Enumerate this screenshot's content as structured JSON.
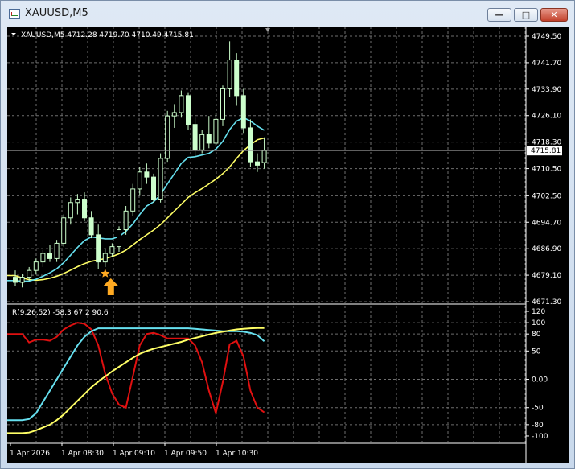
{
  "window": {
    "title": "XAUUSD,M5",
    "min_glyph": "—",
    "max_glyph": "□",
    "close_glyph": "✕"
  },
  "colors": {
    "background": "#000000",
    "grid": "#6e6e6e",
    "text": "#ffffff",
    "candle_bull": "#ccffcc",
    "candle_bear": "#ccffcc",
    "ma_fast": "#66e0ef",
    "ma_slow": "#ffff66",
    "indicator_red": "#e01010",
    "marker": "#ffaa22"
  },
  "chart_data": [
    {
      "type": "candlestick",
      "header": "XAUUSD,M5  4712.28 4719.70 4710.49 4715.81",
      "symbol": "XAUUSD",
      "timeframe": "M5",
      "ohlc_header": [
        "4712.28",
        "4719.70",
        "4710.49",
        "4715.81"
      ],
      "y_ticks": [
        "4749.50",
        "4741.70",
        "4733.90",
        "4726.10",
        "4718.30",
        "4710.50",
        "4702.50",
        "4694.70",
        "4686.90",
        "4679.10",
        "4671.30"
      ],
      "ylim": [
        4671.3,
        4749.5
      ],
      "current_price": "4715.81",
      "x_ticks": [
        "1 Apr 2026",
        "1 Apr 08:30",
        "1 Apr 09:10",
        "1 Apr 09:50",
        "1 Apr 10:30"
      ],
      "candles": [
        {
          "o": 4678.5,
          "h": 4680.5,
          "l": 4676.0,
          "c": 4677.0
        },
        {
          "o": 4677.0,
          "h": 4679.5,
          "l": 4675.5,
          "c": 4678.5
        },
        {
          "o": 4678.5,
          "h": 4681.5,
          "l": 4677.5,
          "c": 4680.5
        },
        {
          "o": 4680.5,
          "h": 4684.0,
          "l": 4679.5,
          "c": 4683.0
        },
        {
          "o": 4683.0,
          "h": 4686.5,
          "l": 4681.5,
          "c": 4685.5
        },
        {
          "o": 4685.5,
          "h": 4688.0,
          "l": 4683.0,
          "c": 4684.0
        },
        {
          "o": 4684.0,
          "h": 4689.5,
          "l": 4683.0,
          "c": 4688.5
        },
        {
          "o": 4688.5,
          "h": 4697.0,
          "l": 4687.5,
          "c": 4696.0
        },
        {
          "o": 4696.0,
          "h": 4702.0,
          "l": 4694.0,
          "c": 4700.5
        },
        {
          "o": 4700.5,
          "h": 4703.0,
          "l": 4697.0,
          "c": 4701.5
        },
        {
          "o": 4701.5,
          "h": 4703.5,
          "l": 4695.0,
          "c": 4696.0
        },
        {
          "o": 4696.0,
          "h": 4698.0,
          "l": 4690.0,
          "c": 4691.0
        },
        {
          "o": 4691.0,
          "h": 4694.0,
          "l": 4681.0,
          "c": 4683.0
        },
        {
          "o": 4683.0,
          "h": 4687.0,
          "l": 4681.5,
          "c": 4685.5
        },
        {
          "o": 4685.5,
          "h": 4688.5,
          "l": 4684.5,
          "c": 4687.5
        },
        {
          "o": 4687.5,
          "h": 4693.5,
          "l": 4686.0,
          "c": 4692.5
        },
        {
          "o": 4692.5,
          "h": 4699.5,
          "l": 4691.0,
          "c": 4698.0
        },
        {
          "o": 4698.0,
          "h": 4706.0,
          "l": 4696.5,
          "c": 4704.5
        },
        {
          "o": 4704.5,
          "h": 4711.0,
          "l": 4702.5,
          "c": 4709.5
        },
        {
          "o": 4709.5,
          "h": 4712.0,
          "l": 4706.0,
          "c": 4708.0
        },
        {
          "o": 4708.0,
          "h": 4709.0,
          "l": 4700.5,
          "c": 4701.5
        },
        {
          "o": 4701.5,
          "h": 4715.0,
          "l": 4700.5,
          "c": 4713.5
        },
        {
          "o": 4713.5,
          "h": 4727.5,
          "l": 4712.5,
          "c": 4726.0
        },
        {
          "o": 4726.0,
          "h": 4729.5,
          "l": 4722.5,
          "c": 4727.0
        },
        {
          "o": 4727.0,
          "h": 4733.5,
          "l": 4725.5,
          "c": 4732.0
        },
        {
          "o": 4732.0,
          "h": 4733.0,
          "l": 4722.0,
          "c": 4723.5
        },
        {
          "o": 4723.5,
          "h": 4725.5,
          "l": 4714.0,
          "c": 4716.0
        },
        {
          "o": 4716.0,
          "h": 4722.0,
          "l": 4715.0,
          "c": 4720.5
        },
        {
          "o": 4720.5,
          "h": 4726.0,
          "l": 4716.5,
          "c": 4718.0
        },
        {
          "o": 4718.0,
          "h": 4727.0,
          "l": 4717.0,
          "c": 4725.0
        },
        {
          "o": 4725.0,
          "h": 4735.0,
          "l": 4723.0,
          "c": 4734.0
        },
        {
          "o": 4734.0,
          "h": 4748.0,
          "l": 4731.5,
          "c": 4742.5
        },
        {
          "o": 4742.5,
          "h": 4744.5,
          "l": 4729.0,
          "c": 4732.0
        },
        {
          "o": 4732.0,
          "h": 4734.0,
          "l": 4721.0,
          "c": 4722.5
        },
        {
          "o": 4722.5,
          "h": 4725.0,
          "l": 4711.0,
          "c": 4712.5
        },
        {
          "o": 4712.5,
          "h": 4715.0,
          "l": 4709.5,
          "c": 4711.5
        },
        {
          "o": 4712.28,
          "h": 4719.7,
          "l": 4710.49,
          "c": 4715.81
        }
      ],
      "ma_fast": [
        4677.5,
        4677.3,
        4677.4,
        4677.9,
        4678.8,
        4679.8,
        4681.0,
        4682.8,
        4685.0,
        4687.3,
        4689.3,
        4690.4,
        4690.1,
        4689.8,
        4689.8,
        4690.5,
        4692.0,
        4694.2,
        4697.0,
        4699.5,
        4700.7,
        4702.8,
        4706.0,
        4709.0,
        4712.0,
        4713.8,
        4714.0,
        4714.5,
        4715.0,
        4716.2,
        4718.5,
        4722.0,
        4724.5,
        4725.5,
        4724.5,
        4723.0,
        4721.8
      ],
      "ma_slow": [
        4679.0,
        4678.3,
        4677.8,
        4677.6,
        4677.8,
        4678.2,
        4678.8,
        4679.6,
        4680.6,
        4681.6,
        4682.5,
        4683.2,
        4683.6,
        4684.0,
        4684.6,
        4685.4,
        4686.5,
        4688.0,
        4689.6,
        4691.0,
        4692.4,
        4694.0,
        4696.0,
        4698.0,
        4700.0,
        4702.0,
        4703.4,
        4704.6,
        4706.0,
        4707.4,
        4709.0,
        4711.0,
        4713.5,
        4715.8,
        4717.5,
        4719.0,
        4719.5
      ],
      "signal_candle_index": 13
    },
    {
      "type": "line",
      "header": "R(9,26,52) -58.3 67.2 90.6",
      "indicator_name": "R(9,26,52)",
      "values_header": [
        "-58.3",
        "67.2",
        "90.6"
      ],
      "y_ticks": [
        "120",
        "100",
        "80",
        "50",
        "0.00",
        "-50",
        "-80",
        "-100"
      ],
      "ylim": [
        -110,
        120
      ],
      "series": [
        {
          "values": [
            80,
            80,
            65,
            70,
            70,
            68,
            75,
            88,
            95,
            100,
            98,
            88,
            60,
            10,
            -25,
            -45,
            -50,
            5,
            60,
            80,
            82,
            78,
            72,
            72,
            72,
            72,
            60,
            30,
            -20,
            -60,
            -5,
            62,
            68,
            40,
            -20,
            -50,
            -58.3
          ]
        },
        {
          "values": [
            -72,
            -72,
            -70,
            -60,
            -40,
            -20,
            0,
            20,
            40,
            60,
            75,
            85,
            90,
            90,
            90,
            90,
            90,
            90,
            90,
            90,
            90,
            90,
            90,
            90,
            90,
            90,
            89,
            88,
            87,
            86,
            85,
            85,
            85,
            84,
            82,
            78,
            67.2
          ]
        },
        {
          "values": [
            -95,
            -95,
            -94,
            -90,
            -85,
            -80,
            -72,
            -62,
            -50,
            -38,
            -26,
            -14,
            -4,
            5,
            14,
            22,
            30,
            38,
            45,
            50,
            54,
            57,
            60,
            63,
            66,
            70,
            73,
            76,
            79,
            82,
            84,
            86,
            88,
            89,
            90,
            90.5,
            90.6
          ]
        }
      ]
    }
  ]
}
